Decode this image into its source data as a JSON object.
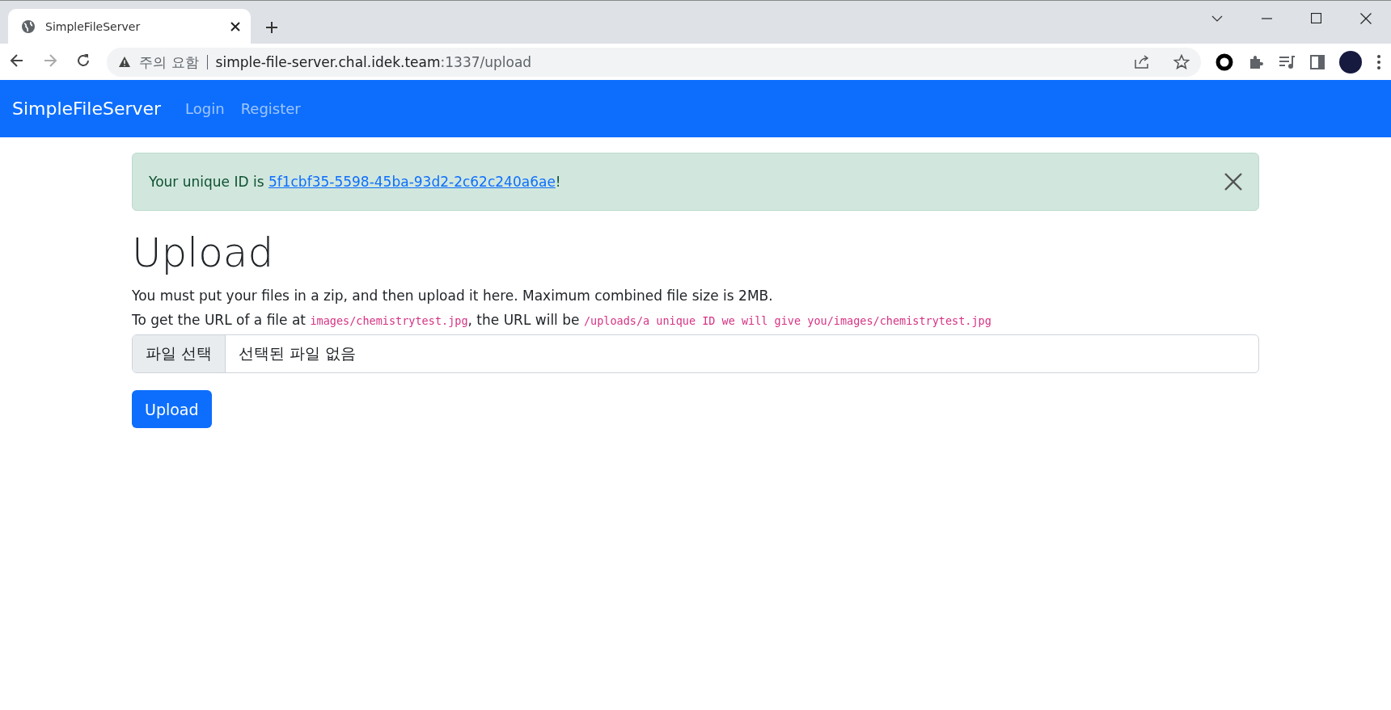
{
  "browser": {
    "tab": {
      "title": "SimpleFileServer",
      "selected": true
    },
    "address": {
      "warning": "주의 요함",
      "host": "simple-file-server.chal.idek.team",
      "path": ":1337/upload"
    }
  },
  "navbar": {
    "brand": "SimpleFileServer",
    "links": [
      {
        "label": "Login"
      },
      {
        "label": "Register"
      }
    ]
  },
  "alert": {
    "segments": [
      {
        "kind": "plain",
        "text": "Your unique ID is "
      },
      {
        "kind": "link",
        "text": "5f1cbf35-5598-45ba-93d2-2c62c240a6ae"
      },
      {
        "kind": "plain",
        "text": "!"
      }
    ]
  },
  "heading": "Upload",
  "paragraphs": [
    {
      "segments": [
        {
          "kind": "plain",
          "text": "You must put your files in a zip, and then upload it here. Maximum combined file size is 2MB."
        }
      ]
    },
    {
      "segments": [
        {
          "kind": "plain",
          "text": "To get the URL of a file at "
        },
        {
          "kind": "code",
          "text": "images/chemistrytest.jpg"
        },
        {
          "kind": "plain",
          "text": ", the URL will be "
        },
        {
          "kind": "code",
          "text": "/uploads/a unique ID we will give you/images/chemistrytest.jpg"
        }
      ]
    }
  ],
  "file_input": {
    "button": "파일 선택",
    "status": "선택된 파일 없음"
  },
  "submit": "Upload"
}
